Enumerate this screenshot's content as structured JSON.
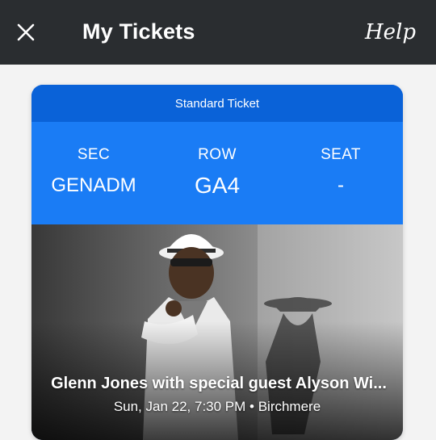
{
  "header": {
    "title": "My Tickets",
    "help_label": "Help",
    "close_icon": "close-icon"
  },
  "ticket": {
    "type_label": "Standard Ticket",
    "sec_label": "SEC",
    "sec_value": "GENADM",
    "row_label": "ROW",
    "row_value": "GA4",
    "seat_label": "SEAT",
    "seat_value": "-"
  },
  "event": {
    "title": "Glenn Jones with special guest Alyson Wi...",
    "date_venue": "Sun, Jan 22, 7:30 PM • Birchmere"
  },
  "colors": {
    "topbar": "#2a2d30",
    "ticket_header": "#0a62d8",
    "ticket_info": "#1a7cf5",
    "background": "#f3f3f3"
  }
}
